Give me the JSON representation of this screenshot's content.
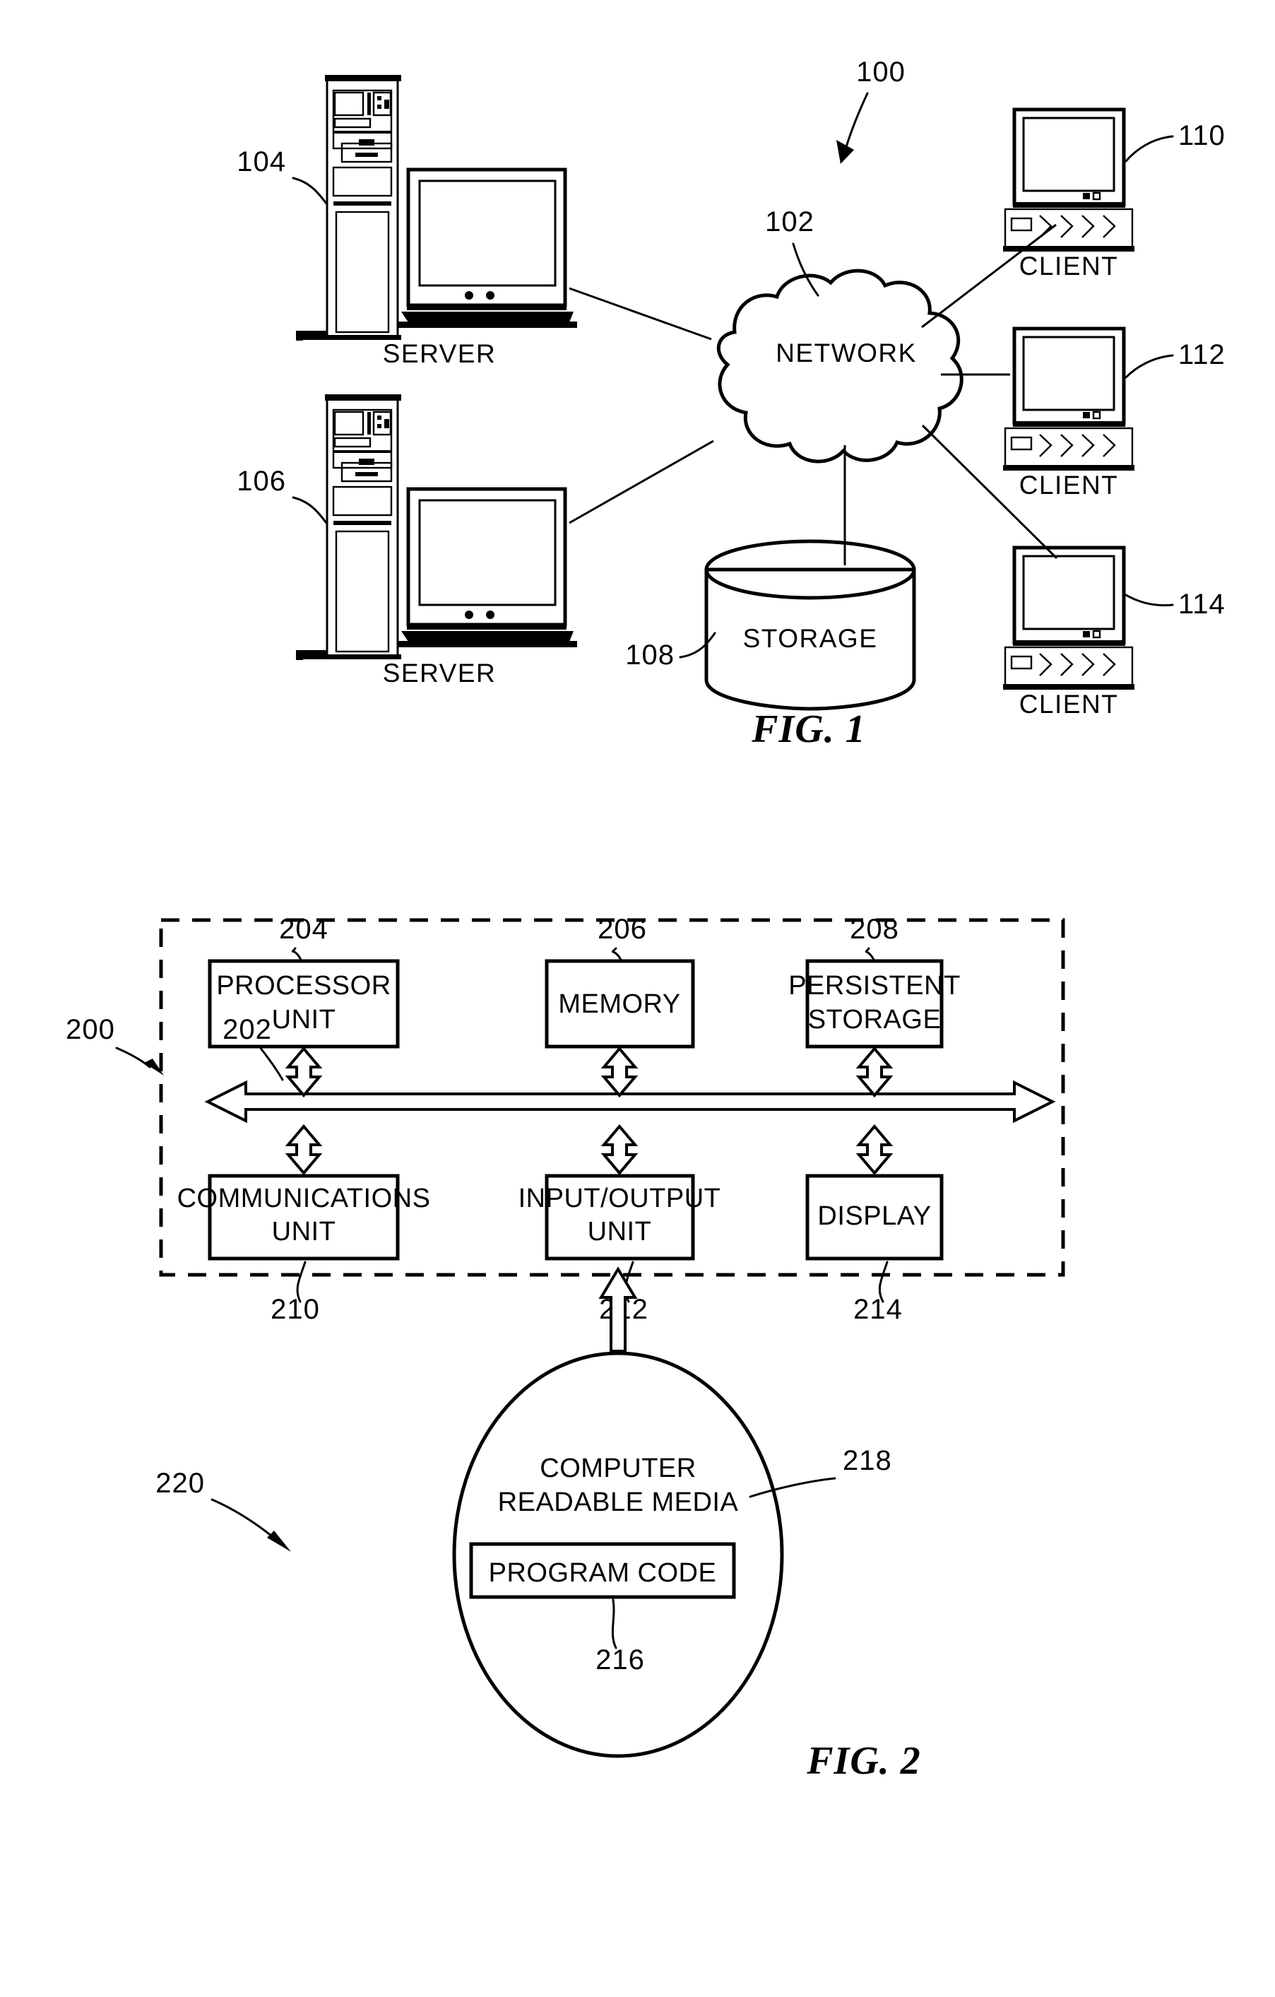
{
  "document": {
    "type": "patent-figure-sheet",
    "background_color": "#ffffff",
    "ink_color": "#000000"
  },
  "figure1": {
    "caption": "FIG. 1",
    "system_ref": "100",
    "nodes": [
      {
        "ref": "104",
        "label": "SERVER",
        "icon": "server-tower-and-monitor-icon"
      },
      {
        "ref": "106",
        "label": "SERVER",
        "icon": "server-tower-and-monitor-icon"
      },
      {
        "ref": "102",
        "label": "NETWORK",
        "icon": "cloud-icon"
      },
      {
        "ref": "108",
        "label": "STORAGE",
        "icon": "cylinder-database-icon"
      },
      {
        "ref": "110",
        "label": "CLIENT",
        "icon": "desktop-computer-icon"
      },
      {
        "ref": "112",
        "label": "CLIENT",
        "icon": "desktop-computer-icon"
      },
      {
        "ref": "114",
        "label": "CLIENT",
        "icon": "desktop-computer-icon"
      }
    ]
  },
  "figure2": {
    "caption": "FIG. 2",
    "data_processing_system_ref": "200",
    "bus_ref": "202",
    "top_row": [
      {
        "ref": "204",
        "lines": [
          "PROCESSOR",
          "UNIT"
        ]
      },
      {
        "ref": "206",
        "lines": [
          "MEMORY"
        ]
      },
      {
        "ref": "208",
        "lines": [
          "PERSISTENT",
          "STORAGE"
        ]
      }
    ],
    "bottom_row": [
      {
        "ref": "210",
        "lines": [
          "COMMUNICATIONS",
          "UNIT"
        ]
      },
      {
        "ref": "212",
        "lines": [
          "INPUT/OUTPUT",
          "UNIT"
        ]
      },
      {
        "ref": "214",
        "lines": [
          "DISPLAY"
        ]
      }
    ],
    "media": {
      "ref_outer": "220",
      "ref_label": "218",
      "lines": [
        "COMPUTER",
        "READABLE MEDIA"
      ],
      "program_code": {
        "ref": "216",
        "label": "PROGRAM CODE"
      }
    }
  }
}
